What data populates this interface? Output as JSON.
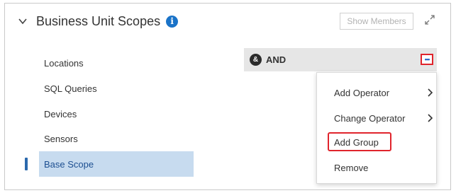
{
  "header": {
    "title": "Business Unit Scopes",
    "info_icon": "info-icon",
    "show_members_label": "Show Members",
    "expand_icon": "expand-icon"
  },
  "nav": {
    "items": [
      {
        "label": "Locations",
        "active": false
      },
      {
        "label": "SQL Queries",
        "active": false
      },
      {
        "label": "Devices",
        "active": false
      },
      {
        "label": "Sensors",
        "active": false
      },
      {
        "label": "Base Scope",
        "active": true
      }
    ]
  },
  "scope": {
    "operator_icon_label": "&",
    "operator_label": "AND",
    "more_icon": "more-dots-icon"
  },
  "context_menu": {
    "items": [
      {
        "label": "Add Operator",
        "has_submenu": true
      },
      {
        "label": "Change Operator",
        "has_submenu": true
      },
      {
        "label": "Add Group",
        "has_submenu": false,
        "highlighted": true
      },
      {
        "label": "Remove",
        "has_submenu": false
      }
    ]
  },
  "colors": {
    "accent": "#1a73c8",
    "active_nav_bg": "#c7dbef",
    "highlight": "#e0242c"
  }
}
